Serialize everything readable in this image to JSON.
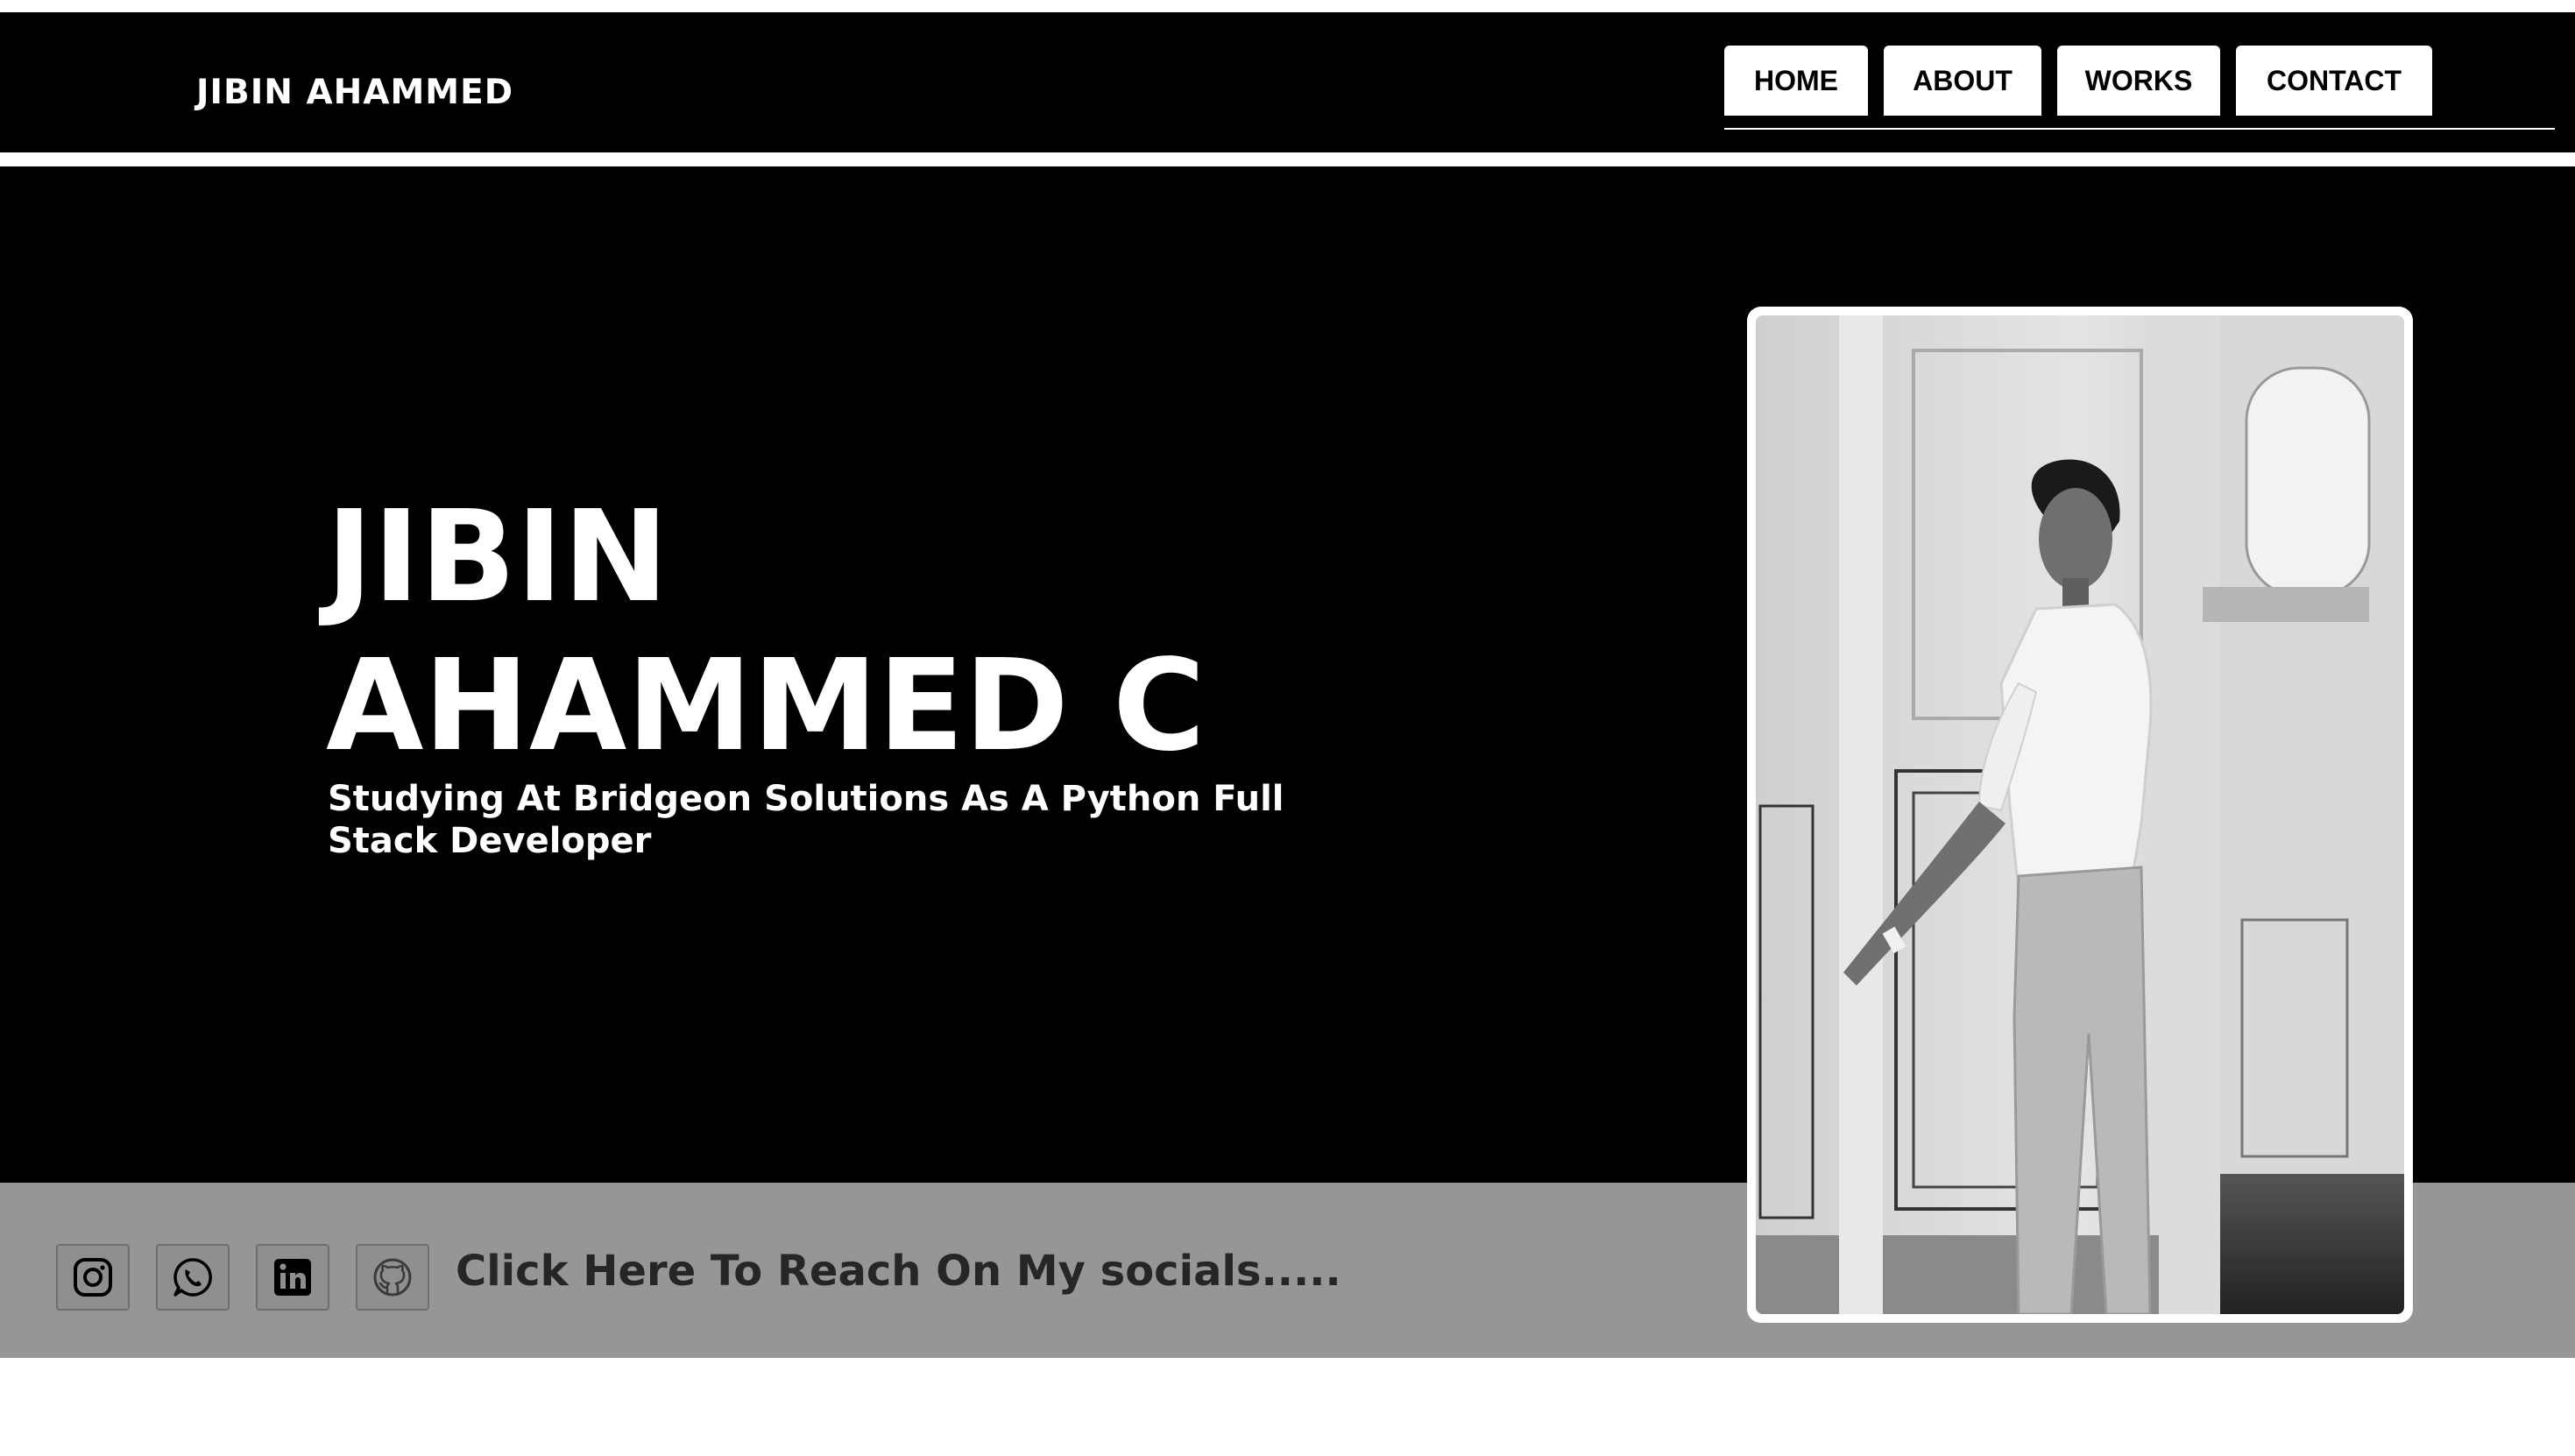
{
  "header": {
    "brand": "JIBIN AHAMMED",
    "nav": [
      {
        "label": "HOME"
      },
      {
        "label": "ABOUT"
      },
      {
        "label": "WORKS"
      },
      {
        "label": "CONTACT"
      }
    ]
  },
  "hero": {
    "name_line1": "JIBIN",
    "name_line2": "AHAMMED C",
    "subtitle": "Studying At Bridgeon Solutions As A Python Full Stack Developer"
  },
  "socials": {
    "icons": [
      "instagram-icon",
      "whatsapp-icon",
      "linkedin-icon",
      "github-icon"
    ],
    "cta_text": "Click Here To Reach On My socials....."
  },
  "colors": {
    "background": "#000000",
    "text": "#ffffff",
    "social_bar": "#969696",
    "social_text": "#262626"
  }
}
